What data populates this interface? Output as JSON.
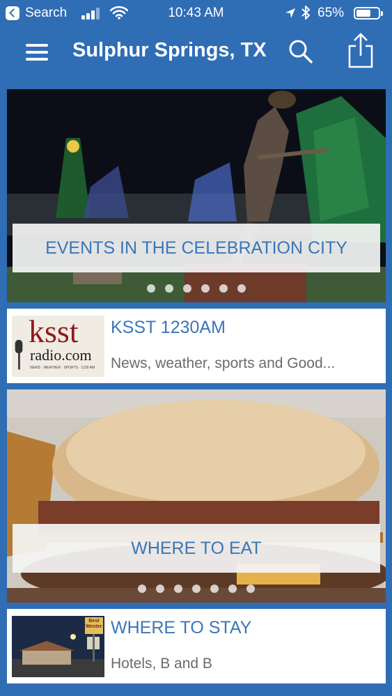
{
  "status_bar": {
    "back_label": "Search",
    "time": "10:43 AM",
    "battery_percent": "65%",
    "battery_level": 0.65
  },
  "nav": {
    "title": "Sulphur Springs, TX"
  },
  "cards": {
    "events": {
      "label": "EVENTS IN THE CELEBRATION CITY"
    },
    "ksst": {
      "title": "KSST 1230AM",
      "subtitle": "News, weather, sports and Good...",
      "logo_top": "ksst",
      "logo_bottom": "radio.com",
      "logo_tagline": "NEWS · WEATHER · SPORTS · 1230 AM"
    },
    "eat": {
      "label": "WHERE TO EAT"
    },
    "stay": {
      "title": "WHERE TO STAY",
      "subtitle": "Hotels, B and B",
      "sign_text": "Best Western"
    }
  },
  "colors": {
    "brand_blue": "#2f6db5",
    "link_blue": "#3a76b8",
    "subtitle_gray": "#6a6a6a"
  },
  "icons": [
    "back-icon",
    "signal-icon",
    "wifi-icon",
    "location-icon",
    "bluetooth-icon",
    "battery-icon",
    "menu-icon",
    "search-icon",
    "share-icon"
  ]
}
